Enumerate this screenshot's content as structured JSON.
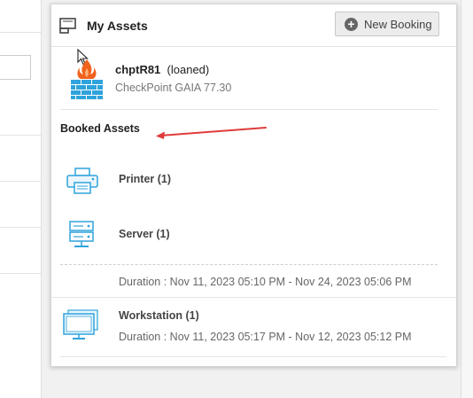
{
  "panel": {
    "title": "My Assets",
    "new_booking_label": "New Booking"
  },
  "loaned_asset": {
    "name": "chptR81",
    "status": "(loaned)",
    "subtitle": "CheckPoint GAIA 77.30",
    "icon": "firewall-icon"
  },
  "booked": {
    "title": "Booked Assets",
    "items": [
      {
        "label": "Printer (1)",
        "icon": "printer-icon"
      },
      {
        "label": "Server (1)",
        "icon": "server-icon",
        "duration": "Duration : Nov 11, 2023 05:10 PM - Nov 24, 2023 05:06 PM"
      },
      {
        "label": "Workstation (1)",
        "icon": "monitor-icon",
        "duration": "Duration : Nov 11, 2023 05:17 PM - Nov 12, 2023 05:12 PM"
      }
    ]
  },
  "colors": {
    "icon_blue": "#2ea3dc",
    "flame": "#f0621d",
    "annotation_arrow": "#e03b3b"
  }
}
